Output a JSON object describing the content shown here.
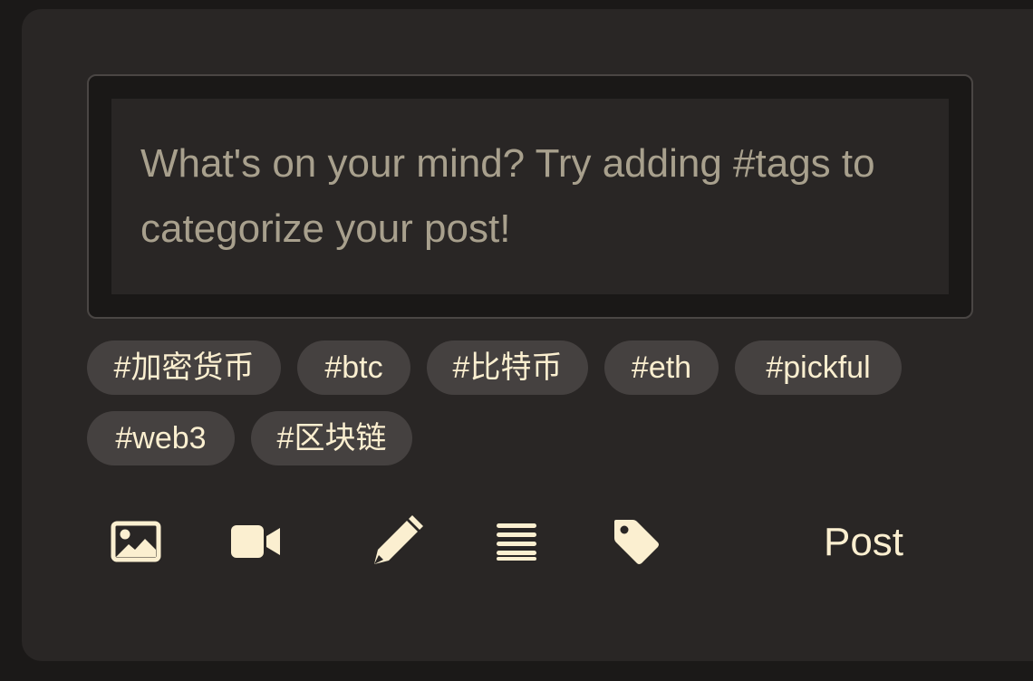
{
  "composer": {
    "placeholder_line1": "What's on your mind? Try adding #tags to",
    "placeholder_line2": "categorize your post!"
  },
  "tags": [
    "#加密货币",
    "#btc",
    "#比特币",
    "#eth",
    "#pickful",
    "#web3",
    "#区块链"
  ],
  "toolbar": {
    "icons": [
      "image-icon",
      "video-icon",
      "pencil-icon",
      "list-icon",
      "tag-icon"
    ],
    "post_label": "Post"
  },
  "colors": {
    "page_background": "#1b1918",
    "card_background": "#292625",
    "placeholder_text": "#a8a08d",
    "accent": "#fbefd0",
    "chip_background": "#454140"
  }
}
